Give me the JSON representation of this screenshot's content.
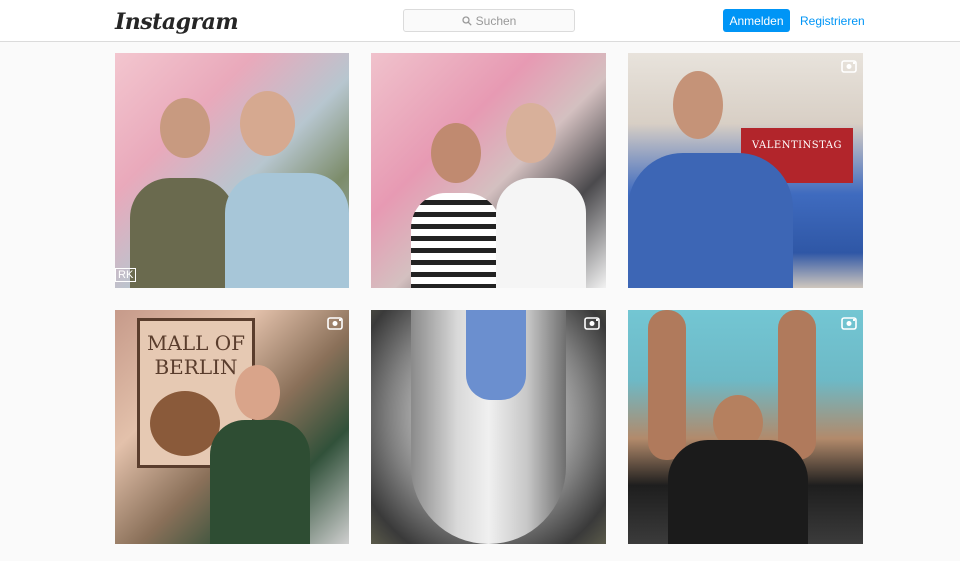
{
  "header": {
    "logo_text": "Instagram",
    "search_placeholder": "Suchen",
    "login_label": "Anmelden",
    "register_label": "Registrieren"
  },
  "colors": {
    "accent": "#0095f6",
    "border": "#dbdbdb",
    "page_background": "#fafafa"
  },
  "posts": [
    {
      "type": "photo",
      "icons": []
    },
    {
      "type": "photo",
      "icons": []
    },
    {
      "type": "video",
      "icons": [
        "video-camera-icon"
      ],
      "sign_text": "VALENTINSTAG"
    },
    {
      "type": "video",
      "icons": [
        "video-camera-icon"
      ],
      "poster_line1": "MALL OF",
      "poster_line2": "BERLIN"
    },
    {
      "type": "video",
      "icons": [
        "video-camera-icon"
      ]
    },
    {
      "type": "video",
      "icons": [
        "video-camera-icon"
      ]
    }
  ]
}
